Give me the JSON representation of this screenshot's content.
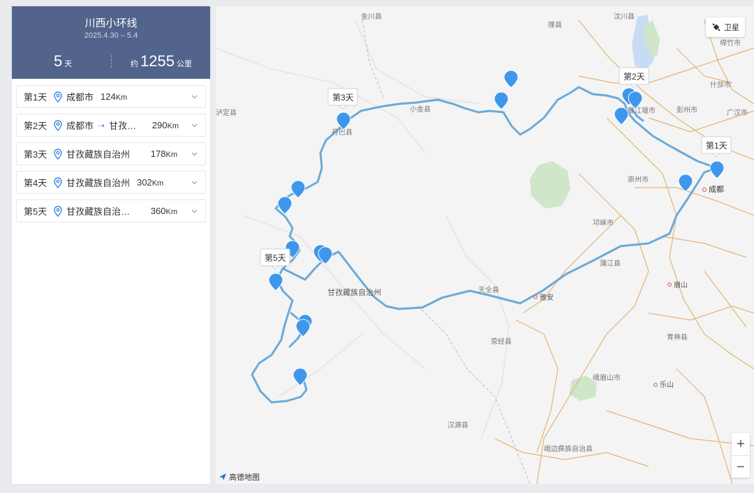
{
  "trip": {
    "title": "川西小环线",
    "dates": "2025.4.30 – 5.4",
    "days_value": "5",
    "days_unit": "天",
    "dist_prefix": "约",
    "dist_value": "1255",
    "dist_unit": "公里"
  },
  "days": [
    {
      "label": "第1天",
      "place": "成都市",
      "dest": "",
      "dist": "124",
      "unit": "Km"
    },
    {
      "label": "第2天",
      "place": "成都市",
      "dest": "甘孜…",
      "dist": "290",
      "unit": "Km"
    },
    {
      "label": "第3天",
      "place": "甘孜藏族自治州",
      "dest": "",
      "dist": "178",
      "unit": "Km"
    },
    {
      "label": "第4天",
      "place": "甘孜藏族自治州",
      "dest": "",
      "dist": "302",
      "unit": "Km"
    },
    {
      "label": "第5天",
      "place": "甘孜藏族自治…",
      "dest": "",
      "dist": "360",
      "unit": "Km"
    }
  ],
  "map": {
    "satellite_label": "卫星",
    "logo_text": "高德地图",
    "zoom_in": "+",
    "zoom_out": "−",
    "callouts": [
      "第1天",
      "第2天",
      "第3天",
      "第5天"
    ],
    "labels": [
      "金川县",
      "汶川县",
      "理县",
      "绵竹市",
      "什邡市",
      "彭州市",
      "广汉市",
      "小金县",
      "丹巴县",
      "都江堰市",
      "崇州市",
      "成都",
      "邛崃市",
      "蒲江县",
      "眉山",
      "天全县",
      "雅安",
      "甘孜藏族自治州",
      "荥经县",
      "青神县",
      "峨眉山市",
      "乐山",
      "汉源县",
      "峨边彝族自治县",
      "泸定县"
    ],
    "colors": {
      "route": "#6aaad8",
      "pin": "#3f97eb",
      "boundary": "#e5b372",
      "water": "#c7dcf2",
      "park": "#cfe6c8",
      "road": "#e4e4e4"
    }
  }
}
